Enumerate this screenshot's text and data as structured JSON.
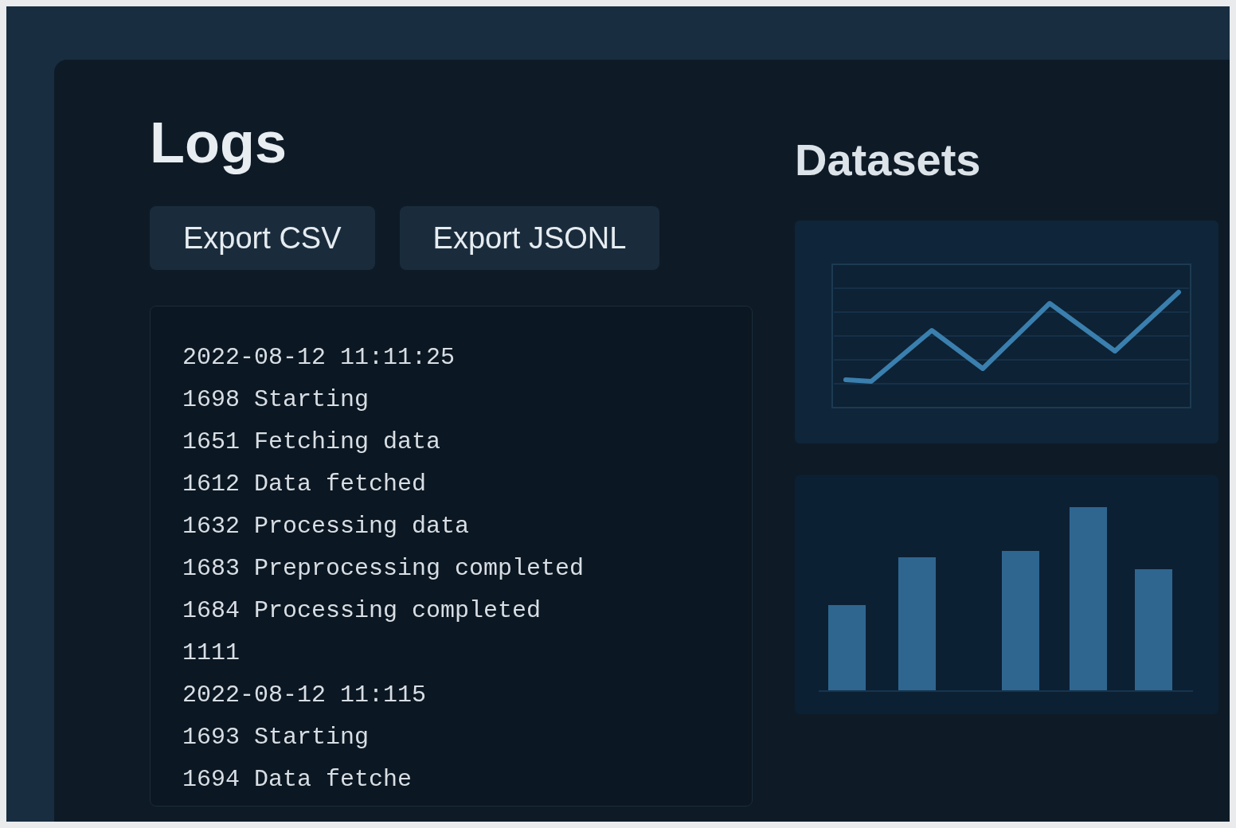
{
  "logs": {
    "title": "Logs",
    "buttons": [
      "Export CSV",
      "Export JSONL"
    ],
    "lines": [
      "2022-08-12 11:11:25",
      "1698 Starting",
      "1651 Fetching data",
      "1612 Data fetched",
      "1632 Processing data",
      "1683 Preprocessing completed",
      "1684 Processing completed",
      "1111",
      "2022-08-12 11:115",
      "1693 Starting",
      "1694 Data fetche"
    ]
  },
  "datasets": {
    "title": "Datasets"
  }
}
